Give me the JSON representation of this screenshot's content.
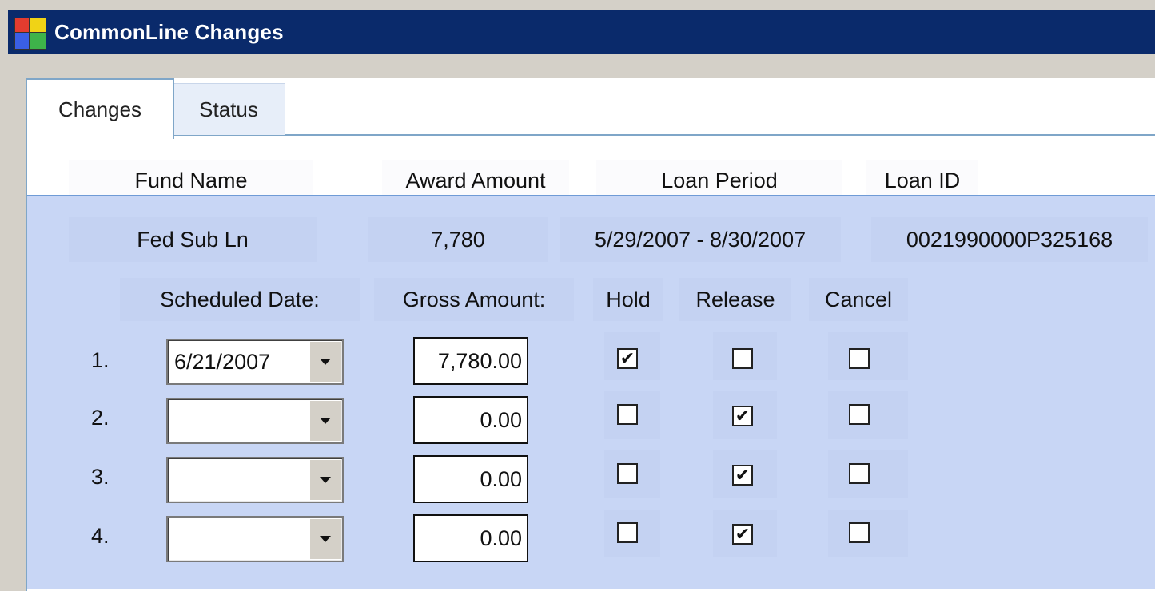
{
  "window": {
    "title": "CommonLine Changes"
  },
  "tabs": [
    {
      "label": "Changes",
      "active": true
    },
    {
      "label": "Status",
      "active": false
    }
  ],
  "columns": {
    "fund_name": "Fund Name",
    "award_amount": "Award Amount",
    "loan_period": "Loan Period",
    "loan_id": "Loan ID"
  },
  "loan": {
    "fund_name": "Fed Sub Ln",
    "award_amount": "7,780",
    "loan_period": "5/29/2007 - 8/30/2007",
    "loan_id": "0021990000P325168"
  },
  "disbursement_headers": {
    "scheduled_date": "Scheduled Date:",
    "gross_amount": "Gross Amount:",
    "hold": "Hold",
    "release": "Release",
    "cancel": "Cancel"
  },
  "disbursements": [
    {
      "number": "1.",
      "date": "6/21/2007",
      "gross": "7,780.00",
      "hold": true,
      "release": false,
      "cancel": false
    },
    {
      "number": "2.",
      "date": "",
      "gross": "0.00",
      "hold": false,
      "release": true,
      "cancel": false
    },
    {
      "number": "3.",
      "date": "",
      "gross": "0.00",
      "hold": false,
      "release": true,
      "cancel": false
    },
    {
      "number": "4.",
      "date": "",
      "gross": "0.00",
      "hold": false,
      "release": true,
      "cancel": false
    }
  ],
  "colors": {
    "titlebar": "#0a2a6b",
    "panel": "#c8d6f5",
    "tab_border": "#7fa6c8"
  }
}
